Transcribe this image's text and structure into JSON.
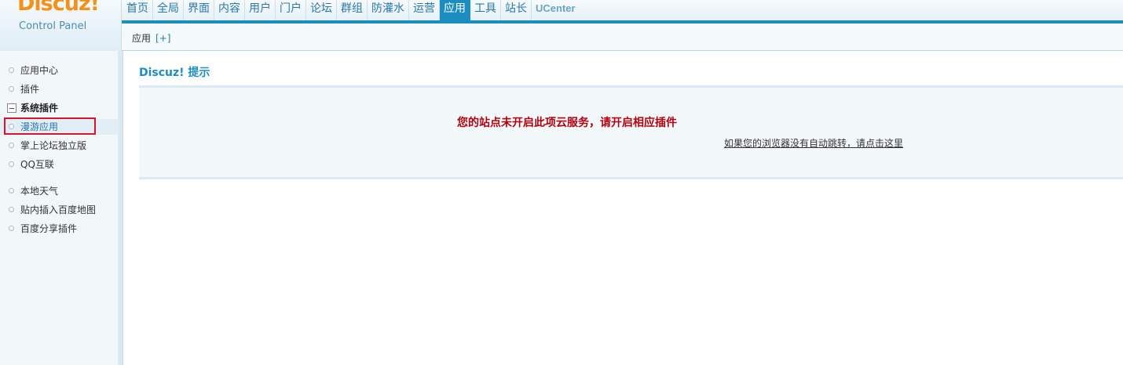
{
  "logo": {
    "mark": "Discuz!",
    "subtitle": "Control Panel"
  },
  "topnav": {
    "items": [
      "首页",
      "全局",
      "界面",
      "内容",
      "用户",
      "门户",
      "论坛",
      "群组",
      "防灌水",
      "运营",
      "应用",
      "工具",
      "站长"
    ],
    "ucenter": "UCenter",
    "active": "应用"
  },
  "subnav": {
    "label": "应用",
    "add": "[+]"
  },
  "sidebar": {
    "items": [
      {
        "label": "应用中心"
      },
      {
        "label": "插件"
      },
      {
        "label": "系统插件"
      },
      {
        "label": "漫游应用"
      },
      {
        "label": "掌上论坛独立版"
      },
      {
        "label": "QQ互联"
      },
      {
        "label": "本地天气"
      },
      {
        "label": "贴内插入百度地图"
      },
      {
        "label": "百度分享插件"
      }
    ]
  },
  "main": {
    "title": "Discuz! 提示",
    "message": "您的站点未开启此项云服务，请开启相应插件",
    "redirect_link": "如果您的浏览器没有自动跳转，请点击这里"
  },
  "colors": {
    "accent": "#1c8dbf",
    "logo": "#f3911b",
    "error": "#b2000e",
    "highlight": "#d9142a"
  }
}
